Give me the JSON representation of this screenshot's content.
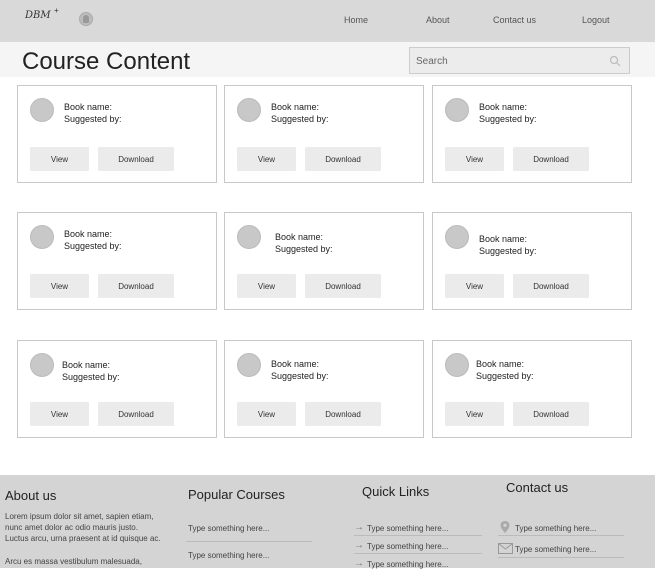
{
  "header": {
    "logo": "DBM",
    "logo_mark": "+",
    "nav": [
      "Home",
      "About",
      "Contact us",
      "Logout"
    ]
  },
  "page": {
    "title": "Course Content",
    "search_placeholder": "Search"
  },
  "cards": [
    {
      "name_label": "Book name:",
      "suggested_label": "Suggested by:",
      "view": "View",
      "download": "Download"
    },
    {
      "name_label": "Book name:",
      "suggested_label": "Suggested by:",
      "view": "View",
      "download": "Download"
    },
    {
      "name_label": "Book name:",
      "suggested_label": "Suggested by:",
      "view": "View",
      "download": "Download"
    },
    {
      "name_label": "Book name:",
      "suggested_label": "Suggested by:",
      "view": "View",
      "download": "Download"
    },
    {
      "name_label": "Book name:",
      "suggested_label": "Suggested by:",
      "view": "View",
      "download": "Download"
    },
    {
      "name_label": "Book name:",
      "suggested_label": "Suggested by:",
      "view": "View",
      "download": "Download"
    },
    {
      "name_label": "Book name:",
      "suggested_label": "Suggested by:",
      "view": "View",
      "download": "Download"
    },
    {
      "name_label": "Book name:",
      "suggested_label": "Suggested by:",
      "view": "View",
      "download": "Download"
    },
    {
      "name_label": "Book name:",
      "suggested_label": "Suggested by:",
      "view": "View",
      "download": "Download"
    }
  ],
  "footer": {
    "about": {
      "heading": "About us",
      "text1": "Lorem ipsum dolor sit amet, sapien etiam,",
      "text2": "nunc amet dolor ac odio mauris justo.",
      "text3": "Luctus arcu, urna praesent at id quisque ac.",
      "text4": "Arcu es massa vestibulum malesuada,"
    },
    "popular": {
      "heading": "Popular Courses",
      "items": [
        "Type something here...",
        "Type something here..."
      ]
    },
    "quick": {
      "heading": "Quick Links",
      "items": [
        "Type something here...",
        "Type something here...",
        "Type something here..."
      ]
    },
    "contact": {
      "heading": "Contact us",
      "items": [
        "Type something here...",
        "Type something here..."
      ]
    }
  }
}
